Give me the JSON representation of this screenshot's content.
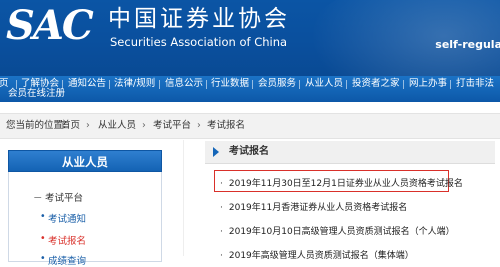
{
  "header": {
    "logo_abbr": "SAC",
    "org_name_cn": "中国证券业协会",
    "org_name_en": "Securities Association of China",
    "slogan": "self-regula"
  },
  "nav": {
    "items": [
      "页",
      "了解协会",
      "通知公告",
      "法律/规则",
      "信息公示",
      "行业数据",
      "会员服务",
      "从业人员",
      "投资者之家",
      "网上办事",
      "打击非法"
    ],
    "sub_item": "会员在线注册"
  },
  "breadcrumb": {
    "prefix": "您当前的位置:",
    "items": [
      "首页",
      "从业人员",
      "考试平台",
      "考试报名"
    ]
  },
  "sidebar": {
    "title": "从业人员",
    "group": {
      "toggle": "－",
      "label": "考试平台"
    },
    "links": [
      {
        "label": "考试通知",
        "active": false
      },
      {
        "label": "考试报名",
        "active": true
      },
      {
        "label": "成绩查询",
        "active": false
      }
    ]
  },
  "main": {
    "section_title": "考试报名",
    "news": [
      {
        "title": "2019年11月30日至12月1日证券业从业人员资格考试报名",
        "highlighted": true
      },
      {
        "title": "2019年11月香港证券从业人员资格考试报名",
        "highlighted": false
      },
      {
        "title": "2019年10月10日高级管理人员资质测试报名（个人端）",
        "highlighted": false
      },
      {
        "title": "2019年高级管理人员资质测试报名（集体端）",
        "highlighted": false
      }
    ]
  },
  "colors": {
    "header_blue": "#0b55a5",
    "nav_blue": "#1566b8",
    "active_link": "#d9302a",
    "link_blue": "#1a5fa8",
    "highlight_border": "#d9302a"
  }
}
